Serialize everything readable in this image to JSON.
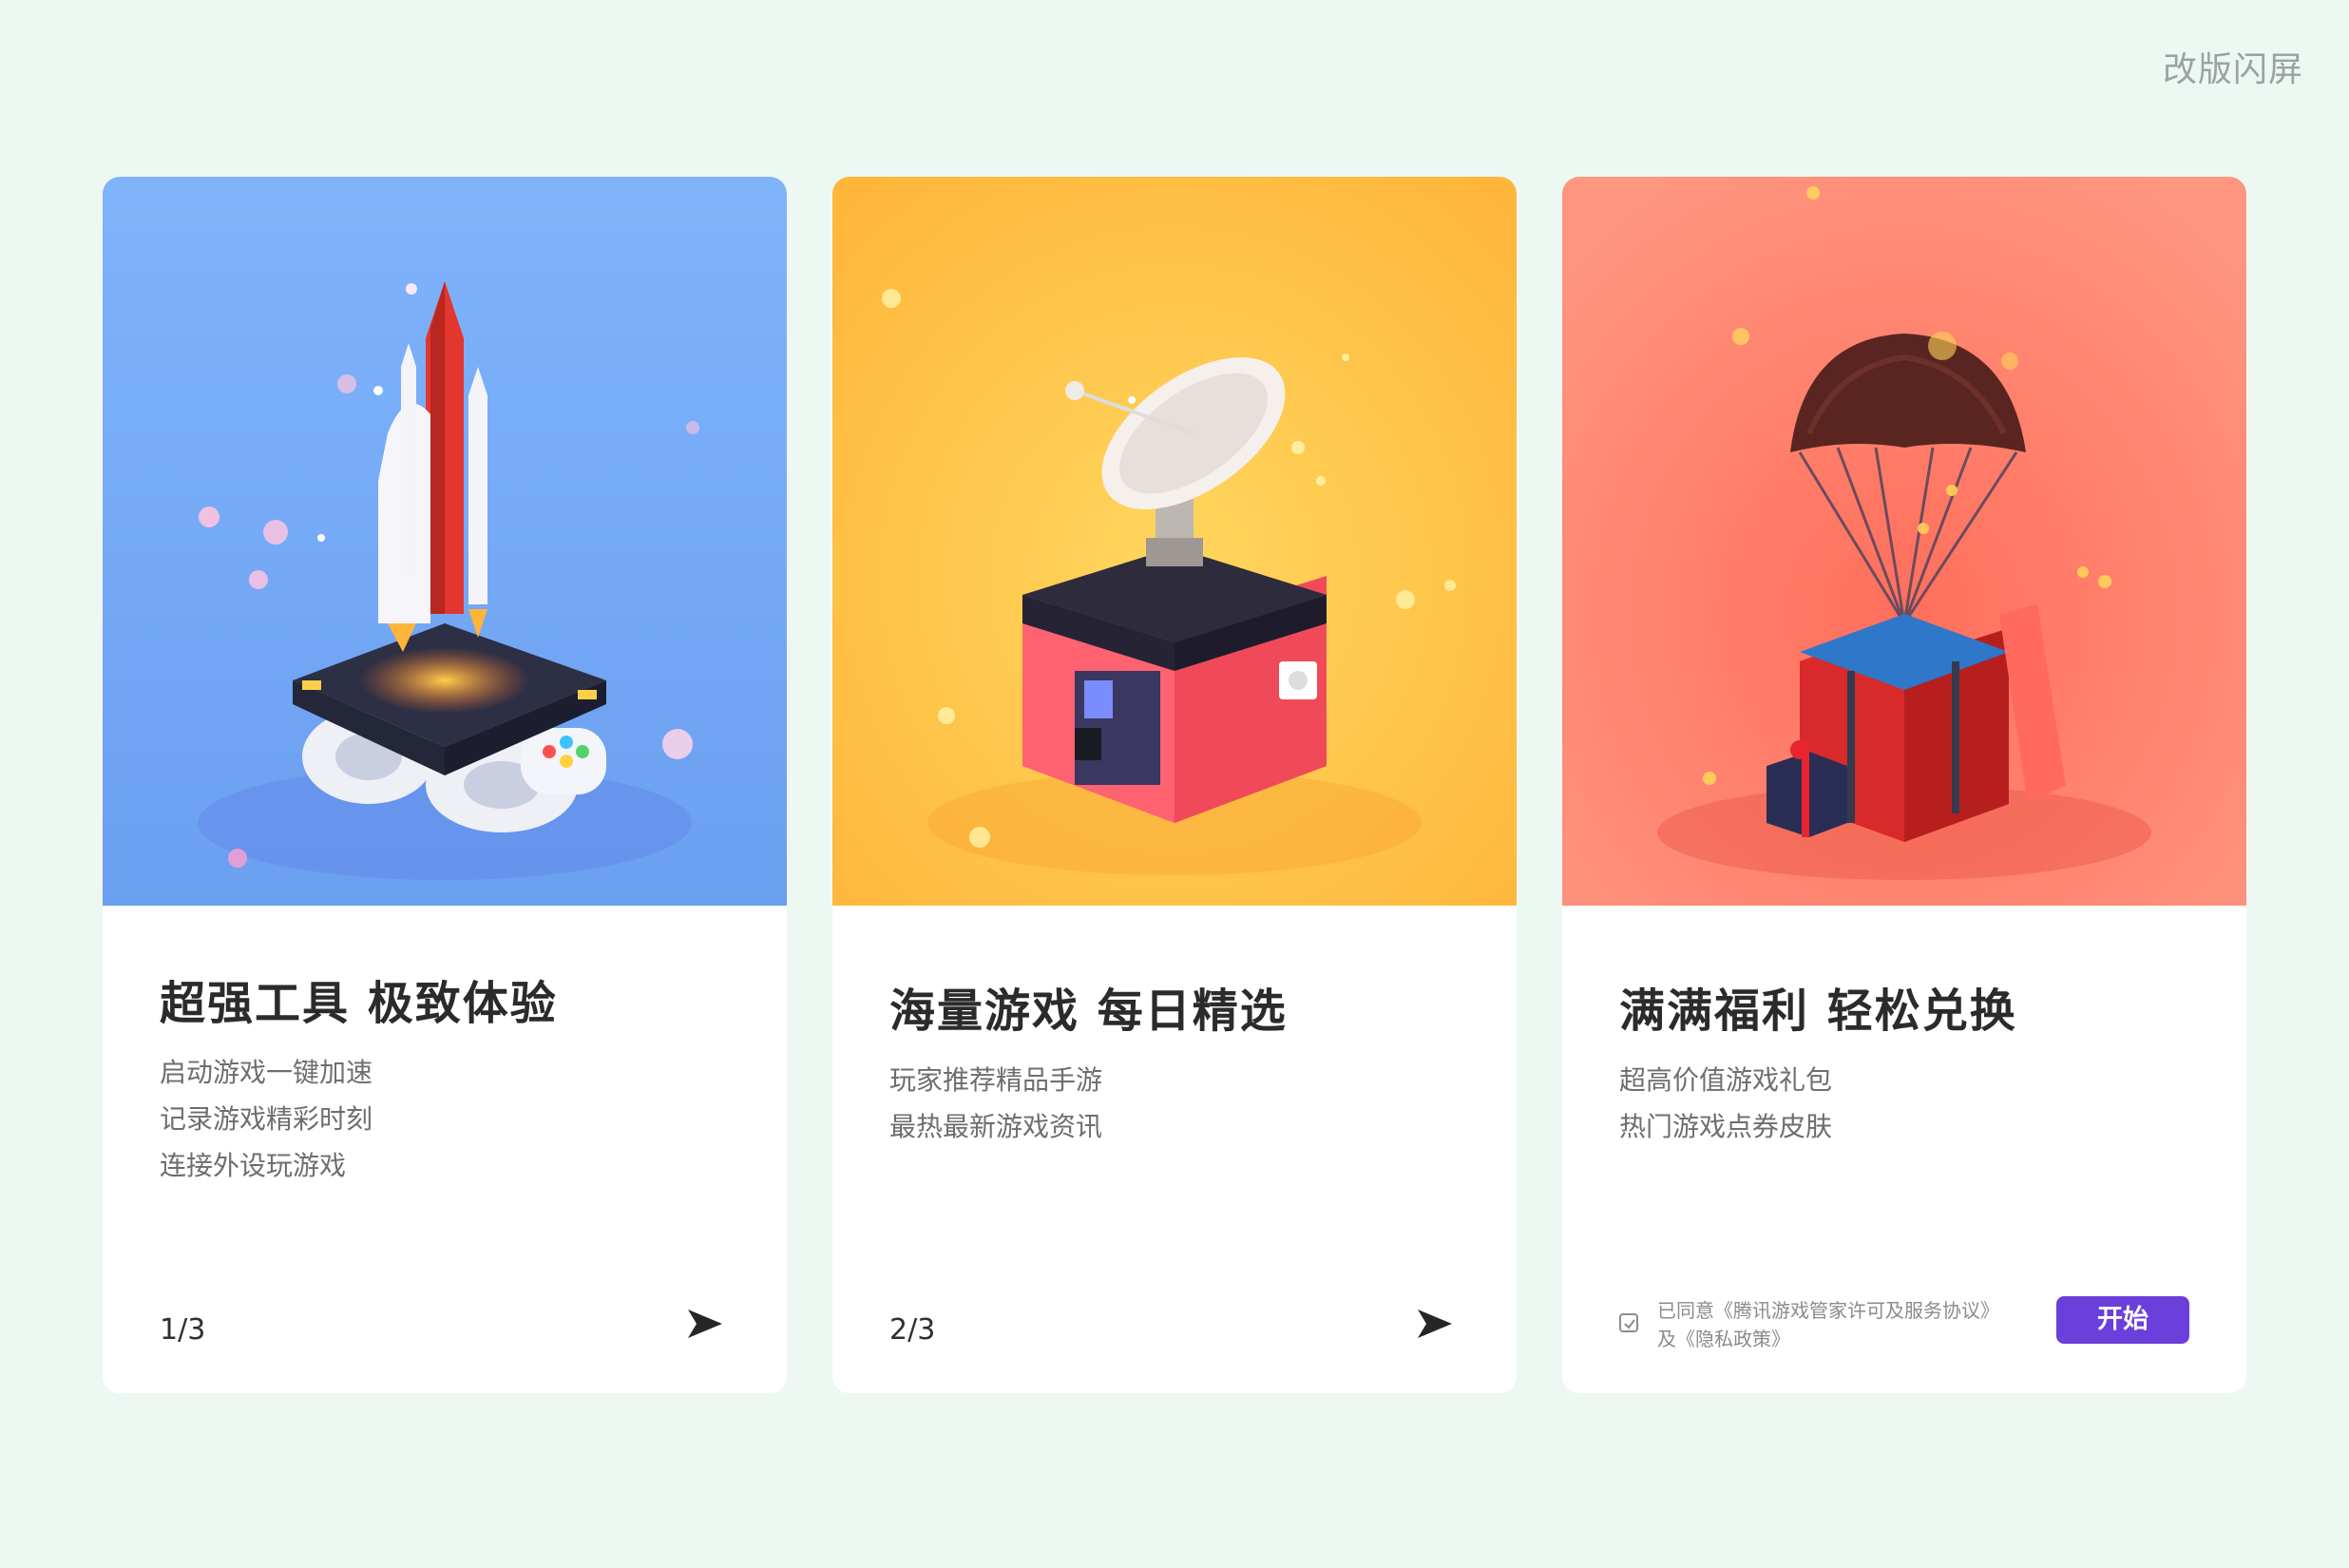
{
  "page": {
    "title": "改版闪屏"
  },
  "cards": [
    {
      "title": "超强工具  极致体验",
      "lines": [
        "启动游戏一键加速",
        "记录游戏精彩时刻",
        "连接外设玩游戏"
      ],
      "pager": "1/3",
      "hero_color": "#80b0f5",
      "illustration": "rocket-on-controller"
    },
    {
      "title": "海量游戏  每日精选",
      "lines": [
        "玩家推荐精品手游",
        "最热最新游戏资讯"
      ],
      "pager": "2/3",
      "hero_color": "#ffc24d",
      "illustration": "satellite-dish-kiosk"
    },
    {
      "title": "满满福利  轻松兑换",
      "lines": [
        "超高价值游戏礼包",
        "热门游戏点券皮肤"
      ],
      "agreement": {
        "line1": "已同意《腾讯游戏管家许可及服务协议》",
        "line2": "及《隐私政策》",
        "checked": true
      },
      "start_label": "开始",
      "hero_color": "#ff8c7a",
      "illustration": "parachute-supply-crate"
    }
  ],
  "colors": {
    "background": "#eef8f3",
    "accent": "#6a3fdb",
    "card": "#ffffff"
  },
  "icons": {
    "next": "arrow-right-icon",
    "checkbox": "checkbox-icon"
  }
}
